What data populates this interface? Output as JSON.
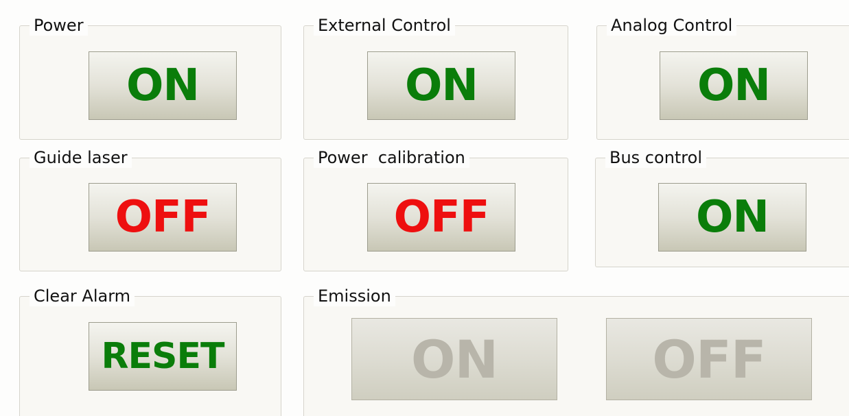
{
  "panels": {
    "power": {
      "title": "Power",
      "state": "ON"
    },
    "external_control": {
      "title": "External Control",
      "state": "ON"
    },
    "analog_control": {
      "title": "Analog Control",
      "state": "ON"
    },
    "guide_laser": {
      "title": "Guide laser",
      "state": "OFF"
    },
    "power_calibration": {
      "title": "Power  calibration",
      "state": "OFF"
    },
    "bus_control": {
      "title": "Bus control",
      "state": "ON"
    },
    "clear_alarm": {
      "title": "Clear Alarm",
      "button": "RESET"
    },
    "emission": {
      "title": "Emission",
      "on_button": "ON",
      "off_button": "OFF",
      "enabled": false
    }
  },
  "colors": {
    "on_text": "#0a7d0a",
    "off_text": "#ee0f0f",
    "disabled_text": "#b8b5aa",
    "button_top": "#f4f4ef",
    "button_bottom": "#c8c7b5",
    "panel_bg": "#f9f8f4",
    "panel_border": "#d6d4cc"
  }
}
